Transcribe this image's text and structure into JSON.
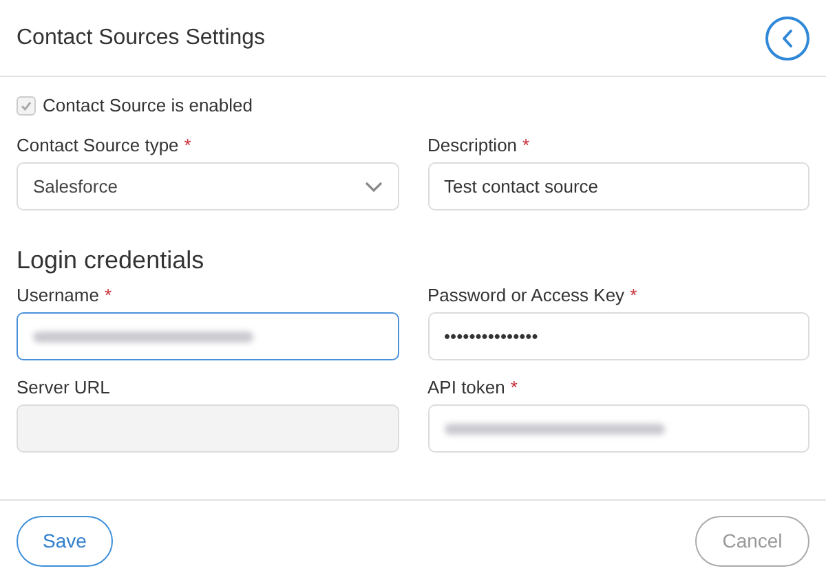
{
  "header": {
    "title": "Contact Sources Settings"
  },
  "enabled": {
    "label": "Contact Source is enabled",
    "checked": true,
    "disabled": true
  },
  "fields": [
    {
      "kind": "select",
      "label": "Contact Source type",
      "required_mark": "*",
      "value": "Salesforce"
    },
    {
      "kind": "text",
      "label": "Description",
      "required_mark": "*",
      "value": "Test contact source"
    }
  ],
  "section": {
    "title": "Login credentials"
  },
  "credentials": [
    {
      "label": "Username",
      "required_mark": "*",
      "redacted": true,
      "focused": true
    },
    {
      "label": "Password or Access Key",
      "required_mark": "*",
      "value": "•••••••••••••••"
    },
    {
      "label": "Server URL",
      "disabled": true
    },
    {
      "label": "API token",
      "required_mark": "*",
      "redacted": true
    }
  ],
  "buttons": [
    {
      "kind": "primary",
      "label": "Save"
    },
    {
      "kind": "secondary",
      "label": "Cancel"
    }
  ]
}
